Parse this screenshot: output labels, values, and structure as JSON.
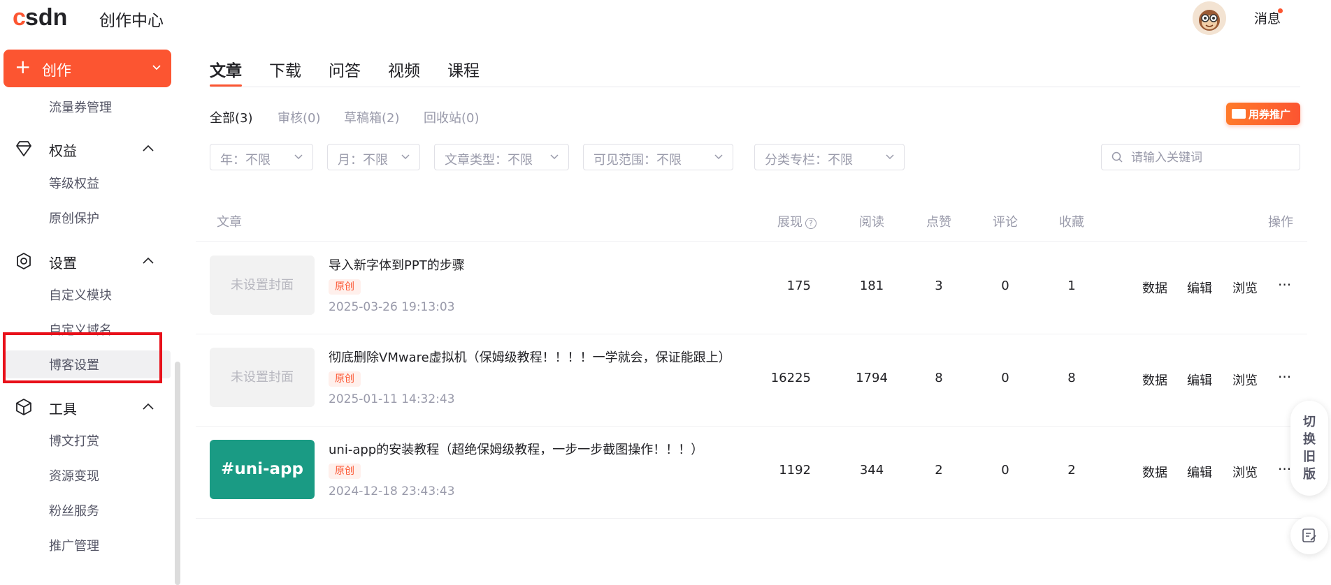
{
  "header": {
    "logo_text": "CSDN",
    "app_title": "创作中心",
    "message_label": "消息"
  },
  "sidebar": {
    "create_label": "创作",
    "create_sub": "流量券管理",
    "groups": [
      {
        "label": "权益",
        "icon": "diamond-icon",
        "items": [
          "等级权益",
          "原创保护"
        ]
      },
      {
        "label": "设置",
        "icon": "gear-icon",
        "items": [
          "自定义模块",
          "自定义域名",
          "博客设置"
        ]
      },
      {
        "label": "工具",
        "icon": "cube-icon",
        "items": [
          "博文打赏",
          "资源变现",
          "粉丝服务",
          "推广管理"
        ]
      }
    ]
  },
  "main": {
    "tabs": [
      "文章",
      "下载",
      "问答",
      "视频",
      "课程"
    ],
    "active_tab": "文章",
    "sub_tabs": [
      "全部(3)",
      "审核(0)",
      "草稿箱(2)",
      "回收站(0)"
    ],
    "promo_label": "用券推广",
    "filters": [
      "年：不限",
      "月：不限",
      "文章类型：不限",
      "可见范围：不限",
      "分类专栏：不限"
    ],
    "search_placeholder": "请输入关键词",
    "columns": {
      "article": "文章",
      "views": "展现",
      "reads": "阅读",
      "likes": "点赞",
      "comments": "评论",
      "favorites": "收藏",
      "actions": "操作"
    },
    "help_glyph": "?",
    "actions": {
      "data": "数据",
      "edit": "编辑",
      "browse": "浏览",
      "more": "···"
    },
    "rows": [
      {
        "cover": "未设置封面",
        "title": "导入新字体到PPT的步骤",
        "badge": "原创",
        "date": "2025-03-26 19:13:03",
        "views": "175",
        "reads": "181",
        "likes": "3",
        "comments": "0",
        "favorites": "1"
      },
      {
        "cover": "未设置封面",
        "title": "彻底删除VMware虚拟机（保姆级教程！！！！一学就会，保证能跟上）",
        "badge": "原创",
        "date": "2025-01-11 14:32:43",
        "views": "16225",
        "reads": "1794",
        "likes": "8",
        "comments": "0",
        "favorites": "8"
      },
      {
        "cover": "#uni-app",
        "title": "uni-app的安装教程（超绝保姆级教程，一步一步截图操作！！！）",
        "badge": "原创",
        "date": "2024-12-18 23:43:43",
        "views": "1192",
        "reads": "344",
        "likes": "2",
        "comments": "0",
        "favorites": "2"
      }
    ]
  },
  "floating": {
    "switch_chars": [
      "切",
      "换",
      "旧",
      "版"
    ]
  },
  "colors": {
    "accent": "#fc5531",
    "highlight_box": "#e8101a",
    "uni_cover": "#1a9b84"
  }
}
